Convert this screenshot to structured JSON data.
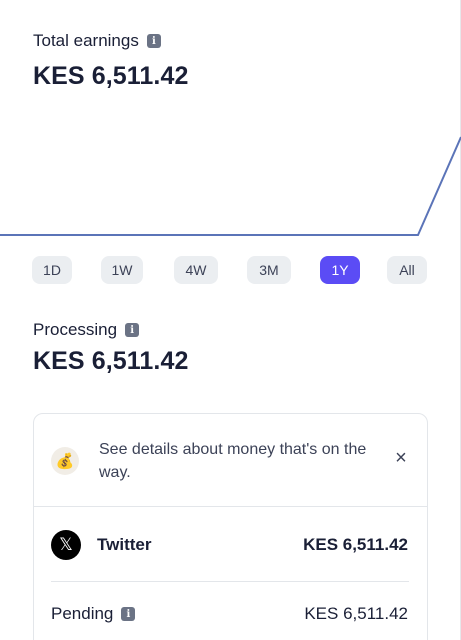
{
  "total": {
    "label": "Total earnings",
    "amount": "KES 6,511.42"
  },
  "chart_data": {
    "type": "line",
    "series": [
      {
        "values": [
          0,
          0,
          0,
          0,
          0,
          0,
          0,
          0,
          0,
          0,
          0,
          1
        ]
      }
    ],
    "color": "#5b74b8"
  },
  "ranges": {
    "items": [
      "1D",
      "1W",
      "4W",
      "3M",
      "1Y",
      "All"
    ],
    "active": "1Y"
  },
  "processing": {
    "label": "Processing",
    "amount": "KES 6,511.42"
  },
  "notice": {
    "text": "See details about money that's on the way.",
    "icon": "money-bag-icon",
    "close": "×"
  },
  "source": {
    "name": "Twitter",
    "logo": "𝕏",
    "amount": "KES 6,511.42"
  },
  "pending": {
    "label": "Pending",
    "amount": "KES 6,511.42"
  },
  "colors": {
    "accent": "#5b4cf5",
    "chip": "#ebeef1",
    "text": "#1a1f36"
  }
}
